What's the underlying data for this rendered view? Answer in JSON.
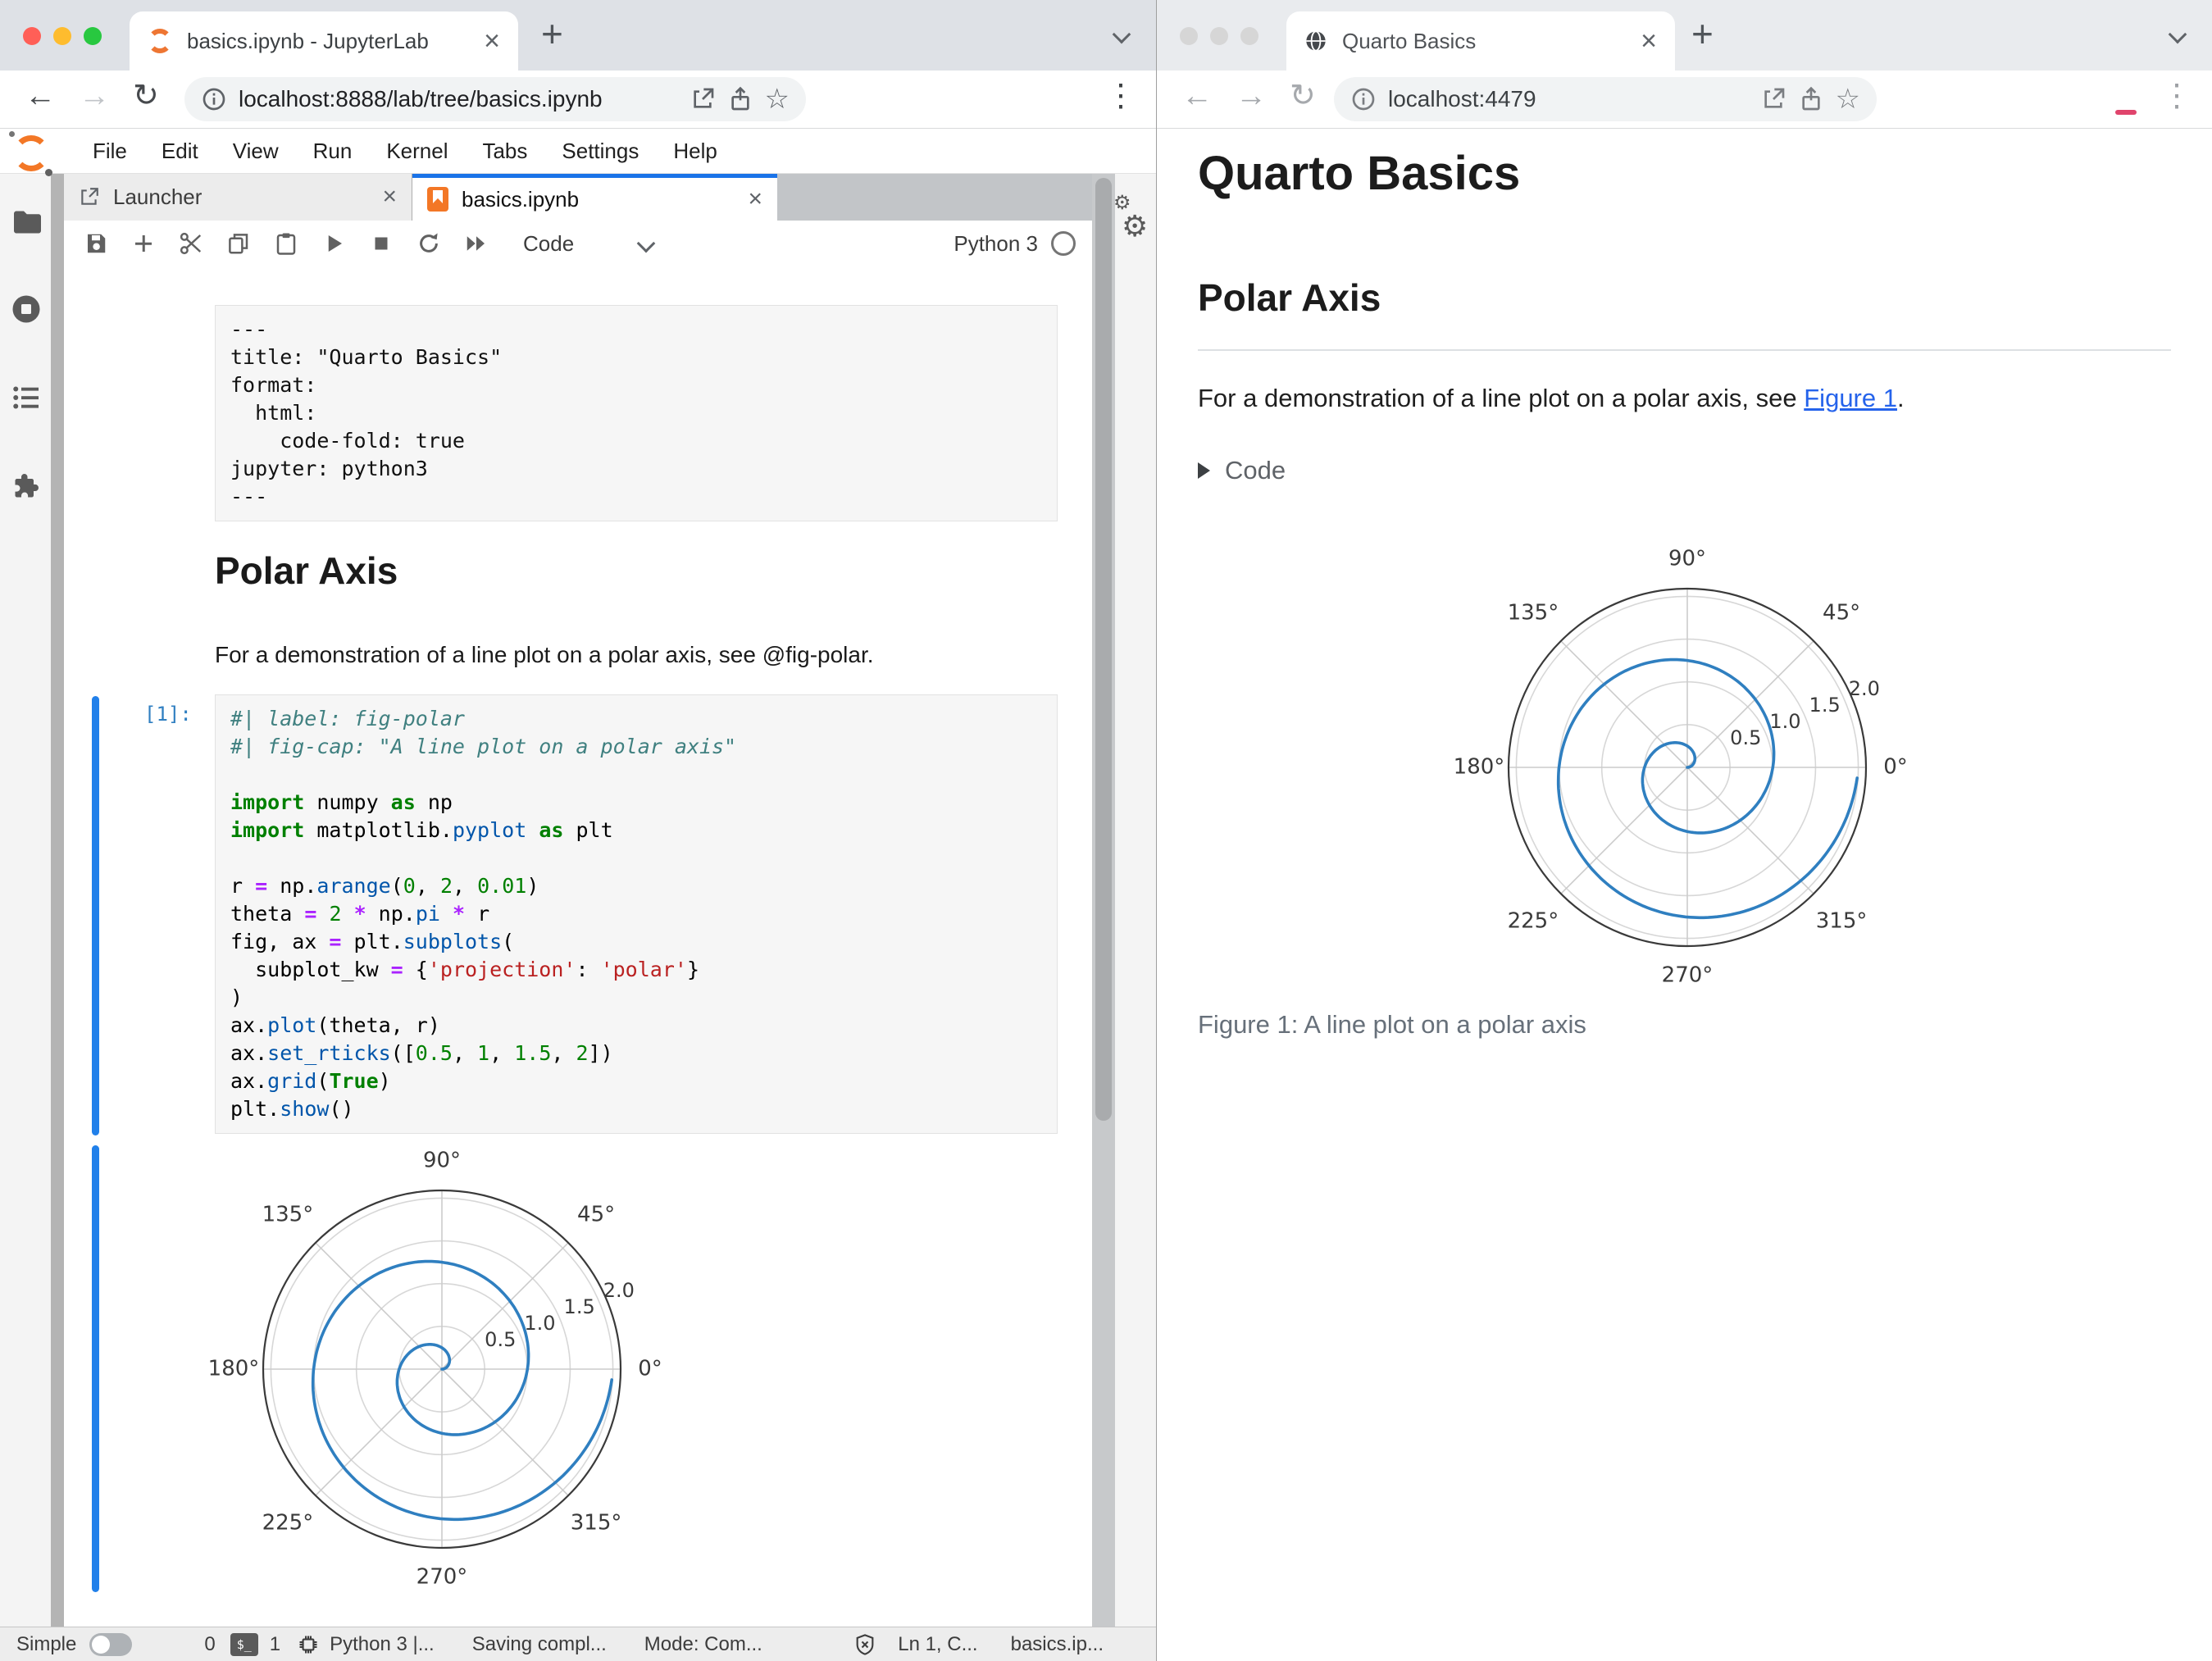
{
  "left_window": {
    "browser_tab": {
      "title": "basics.ipynb - JupyterLab"
    },
    "address_url": "localhost:8888/lab/tree/basics.ipynb",
    "menu_items": [
      "File",
      "Edit",
      "View",
      "Run",
      "Kernel",
      "Tabs",
      "Settings",
      "Help"
    ],
    "doc_tabs": {
      "launcher": "Launcher",
      "notebook": "basics.ipynb"
    },
    "toolbar": {
      "cell_type": "Code",
      "kernel_name": "Python 3"
    },
    "notebook": {
      "yaml_lines": [
        "---",
        "title: \"Quarto Basics\"",
        "format:",
        "  html:",
        "    code-fold: true",
        "jupyter: python3",
        "---"
      ],
      "heading": "Polar Axis",
      "paragraph": "For a demonstration of a line plot on a polar axis, see @fig-polar.",
      "code_prompt": "[1]:",
      "code_lines": [
        [
          [
            "cmt",
            "#| label: fig-polar"
          ]
        ],
        [
          [
            "cmt",
            "#| fig-cap: \"A line plot on a polar axis\""
          ]
        ],
        [],
        [
          [
            "kw",
            "import"
          ],
          [
            "txt",
            " numpy "
          ],
          [
            "kw",
            "as"
          ],
          [
            "txt",
            " np"
          ]
        ],
        [
          [
            "kw",
            "import"
          ],
          [
            "txt",
            " matplotlib."
          ],
          [
            "fn",
            "pyplot"
          ],
          [
            "txt",
            " "
          ],
          [
            "kw",
            "as"
          ],
          [
            "txt",
            " plt"
          ]
        ],
        [],
        [
          [
            "txt",
            "r "
          ],
          [
            "op",
            "="
          ],
          [
            "txt",
            " np."
          ],
          [
            "fn",
            "arange"
          ],
          [
            "txt",
            "("
          ],
          [
            "num",
            "0"
          ],
          [
            "txt",
            ", "
          ],
          [
            "num",
            "2"
          ],
          [
            "txt",
            ", "
          ],
          [
            "num",
            "0.01"
          ],
          [
            "txt",
            ")"
          ]
        ],
        [
          [
            "txt",
            "theta "
          ],
          [
            "op",
            "="
          ],
          [
            "txt",
            " "
          ],
          [
            "num",
            "2"
          ],
          [
            "txt",
            " "
          ],
          [
            "op",
            "*"
          ],
          [
            "txt",
            " np."
          ],
          [
            "fn",
            "pi"
          ],
          [
            "txt",
            " "
          ],
          [
            "op",
            "*"
          ],
          [
            "txt",
            " r"
          ]
        ],
        [
          [
            "txt",
            "fig, ax "
          ],
          [
            "op",
            "="
          ],
          [
            "txt",
            " plt."
          ],
          [
            "fn",
            "subplots"
          ],
          [
            "txt",
            "("
          ]
        ],
        [
          [
            "txt",
            "  subplot_kw "
          ],
          [
            "op",
            "="
          ],
          [
            "txt",
            " {"
          ],
          [
            "str",
            "'projection'"
          ],
          [
            "txt",
            ": "
          ],
          [
            "str",
            "'polar'"
          ],
          [
            "txt",
            "}"
          ]
        ],
        [
          [
            "txt",
            ")"
          ]
        ],
        [
          [
            "txt",
            "ax."
          ],
          [
            "fn",
            "plot"
          ],
          [
            "txt",
            "(theta, r)"
          ]
        ],
        [
          [
            "txt",
            "ax."
          ],
          [
            "fn",
            "set_rticks"
          ],
          [
            "txt",
            "(["
          ],
          [
            "num",
            "0.5"
          ],
          [
            "txt",
            ", "
          ],
          [
            "num",
            "1"
          ],
          [
            "txt",
            ", "
          ],
          [
            "num",
            "1.5"
          ],
          [
            "txt",
            ", "
          ],
          [
            "num",
            "2"
          ],
          [
            "txt",
            "])"
          ]
        ],
        [
          [
            "txt",
            "ax."
          ],
          [
            "fn",
            "grid"
          ],
          [
            "txt",
            "("
          ],
          [
            "kw",
            "True"
          ],
          [
            "txt",
            ")"
          ]
        ],
        [
          [
            "txt",
            "plt."
          ],
          [
            "fn",
            "show"
          ],
          [
            "txt",
            "()"
          ]
        ]
      ]
    },
    "statusbar": {
      "mode_toggle_label": "Simple",
      "terminal_count": "0",
      "terminal_glyph": "$_",
      "kernel_count": "1",
      "kernel_status": "Python 3 |...",
      "saving": "Saving compl...",
      "mode": "Mode: Com...",
      "cursor": "Ln 1, C...",
      "filename": "basics.ip..."
    }
  },
  "right_window": {
    "browser_tab": {
      "title": "Quarto Basics"
    },
    "address_url": "localhost:4479",
    "page": {
      "title": "Quarto Basics",
      "section_heading": "Polar Axis",
      "para_prefix": "For a demonstration of a line plot on a polar axis, see ",
      "link_text": "Figure 1",
      "para_suffix": ".",
      "code_toggle_label": "Code",
      "figure_caption": "Figure 1: A line plot on a polar axis"
    }
  },
  "accent_colors": {
    "jupyter_orange": "#f37726",
    "active_tab_border": "#1a73e8",
    "cell_collapser": "#2180ea",
    "link": "#2563eb",
    "traffic_lights": [
      "#ff5f57",
      "#febc2e",
      "#28c840"
    ]
  },
  "chart_data": {
    "type": "line",
    "projection": "polar",
    "title": "",
    "description": "Archimedean spiral: r from 0 to 2 (step 0.01), theta = 2 * pi * r (two revolutions, counterclockwise from 0°)",
    "r_range": [
      0,
      2
    ],
    "r_step": 0.01,
    "theta_formula": "theta = 2 * pi * r",
    "rticks": [
      0.5,
      1.0,
      1.5,
      2.0
    ],
    "rtick_labels": [
      "0.5",
      "1.0",
      "1.5",
      "2.0"
    ],
    "rlim_max": 2.09,
    "theta_ticks_deg": [
      0,
      45,
      90,
      135,
      180,
      225,
      270,
      315
    ],
    "theta_tick_labels": [
      "0°",
      "45°",
      "90°",
      "135°",
      "180°",
      "225°",
      "270°",
      "315°"
    ],
    "grid": true,
    "line_color": "#2f7fc0",
    "caption": "A line plot on a polar axis"
  }
}
